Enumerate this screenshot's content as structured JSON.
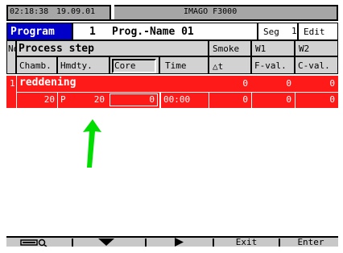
{
  "status": {
    "time": "02:18:38",
    "date": "19.09.01",
    "device": "IMAGO F3000"
  },
  "program": {
    "label": "Program",
    "number": "1",
    "name": "Prog.-Name 01",
    "seg_label": "Seg",
    "seg_value": "1",
    "edit_label": "Edit"
  },
  "headers": {
    "no": "No",
    "process_step": "Process step",
    "smoke": "Smoke",
    "w1": "W1",
    "w2": "W2",
    "chamb": "Chamb.",
    "hmdty": "Hmdty.",
    "core": "Core",
    "time": "Time",
    "delta_t": "△t",
    "fval": "F-val.",
    "cval": "C-val."
  },
  "rows": [
    {
      "no": "1",
      "name": "reddening",
      "smoke": "0",
      "w1": "0",
      "w2": "0",
      "chamb": "20",
      "mode": "P",
      "hmdty": "20",
      "core": "0",
      "time": "00:00",
      "delta_t": "0",
      "fval": "0",
      "cval": "0"
    }
  ],
  "softkeys": {
    "exit": "Exit",
    "enter": "Enter"
  },
  "colors": {
    "accent": "#0000c8",
    "highlight": "#ff1a1a",
    "annotation": "#00dd00",
    "statusbar": "#a6a6a6"
  },
  "icons": [
    "battery-search-icon",
    "down-arrow-icon",
    "right-arrow-icon"
  ]
}
